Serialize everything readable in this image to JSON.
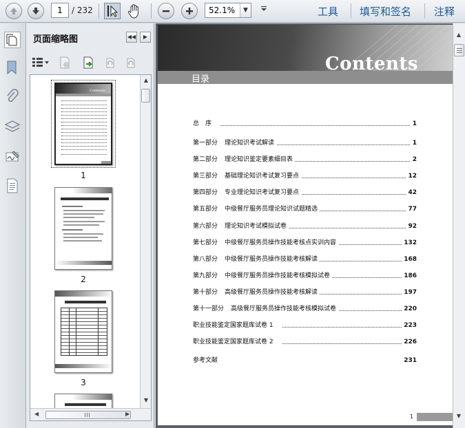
{
  "toolbar": {
    "page_number": "1",
    "page_total": "/ 232",
    "zoom": "52.1%",
    "links": {
      "tools": "工具",
      "sign": "填写和签名",
      "comment": "注释"
    },
    "icons": [
      "prev-page-icon",
      "next-page-icon",
      "select-tool-icon",
      "hand-tool-icon",
      "zoom-out-icon",
      "zoom-in-icon",
      "menu-arrow-icon"
    ]
  },
  "thumbnail_panel": {
    "title": "页面缩略图",
    "thumbnails": [
      {
        "label": "1"
      },
      {
        "label": "2"
      },
      {
        "label": "3"
      }
    ]
  },
  "document": {
    "banner_title": "Contents",
    "section_header": "目录",
    "toc": [
      {
        "part": "总　序",
        "title": "",
        "page": "1"
      },
      {
        "part": "第一部分",
        "title": "理论知识考试解读",
        "page": "1"
      },
      {
        "part": "第二部分",
        "title": "理论知识鉴定要素细目表",
        "page": "2"
      },
      {
        "part": "第三部分",
        "title": "基础理论知识考试复习要点",
        "page": "12"
      },
      {
        "part": "第四部分",
        "title": "专业理论知识考试复习要点",
        "page": "42"
      },
      {
        "part": "第五部分",
        "title": "中级餐厅服务员理论知识试题精选",
        "page": "77"
      },
      {
        "part": "第六部分",
        "title": "理论知识考试模拟试卷",
        "page": "92"
      },
      {
        "part": "第七部分",
        "title": "中级餐厅服务员操作技能考核点实训内容",
        "page": "132"
      },
      {
        "part": "第八部分",
        "title": "中级餐厅服务员操作技能考核解读",
        "page": "168"
      },
      {
        "part": "第九部分",
        "title": "中级餐厅服务员操作技能考核模拟试卷",
        "page": "186"
      },
      {
        "part": "第十部分",
        "title": "高级餐厅服务员操作技能考核解读",
        "page": "197"
      },
      {
        "part": "第十一部分",
        "title": "高级餐厅服务员操作技能考核模拟试卷",
        "page": "220"
      },
      {
        "part": "职业技能鉴定国家题库试卷 1",
        "title": "",
        "page": "223"
      },
      {
        "part": "职业技能鉴定国家题库试卷 2",
        "title": "",
        "page": "226"
      },
      {
        "part": "参考文献",
        "title": "",
        "page": "231"
      }
    ],
    "footer_page": "1"
  }
}
